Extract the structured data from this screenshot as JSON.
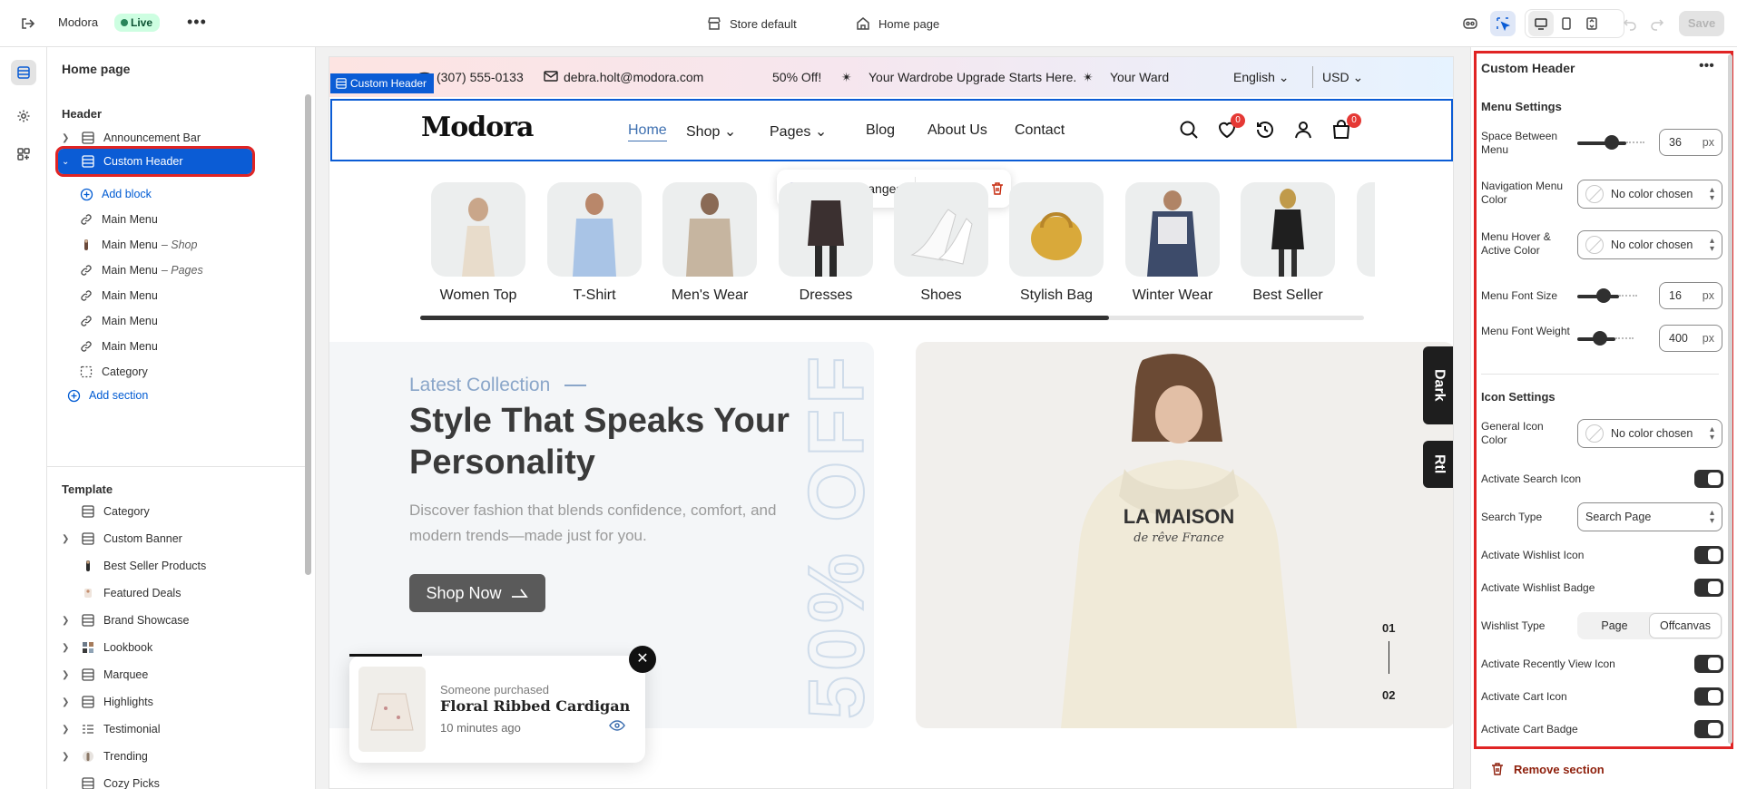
{
  "topbar": {
    "store_name": "Modora",
    "live_badge": "Live",
    "store_select": "Store default",
    "page_select": "Home page",
    "save_label": "Save"
  },
  "sidebar": {
    "title": "Home page",
    "header_group": "Header",
    "header_items": [
      {
        "label": "Announcement Bar",
        "icon": "section-icon"
      },
      {
        "label": "Custom Header",
        "icon": "section-icon"
      },
      {
        "label": "Add block",
        "icon": "add-icon"
      },
      {
        "label": "Main Menu",
        "sub": "",
        "icon": "link-icon"
      },
      {
        "label": "Main Menu",
        "sub": "– Shop",
        "icon": "image-icon"
      },
      {
        "label": "Main Menu",
        "sub": "– Pages",
        "icon": "link-icon"
      },
      {
        "label": "Main Menu",
        "sub": "",
        "icon": "link-icon"
      },
      {
        "label": "Main Menu",
        "sub": "",
        "icon": "link-icon"
      },
      {
        "label": "Main Menu",
        "sub": "",
        "icon": "link-icon"
      },
      {
        "label": "Category",
        "icon": "dashed-box-icon"
      },
      {
        "label": "Add section",
        "icon": "add-icon"
      }
    ],
    "template_group": "Template",
    "template_items": [
      {
        "label": "Category"
      },
      {
        "label": "Custom Banner"
      },
      {
        "label": "Best Seller Products"
      },
      {
        "label": "Featured Deals"
      },
      {
        "label": "Brand Showcase"
      },
      {
        "label": "Lookbook"
      },
      {
        "label": "Marquee"
      },
      {
        "label": "Highlights"
      },
      {
        "label": "Testimonial"
      },
      {
        "label": "Trending"
      },
      {
        "label": "Cozy Picks"
      }
    ]
  },
  "preview": {
    "announcement": {
      "phone": "(307) 555-0133",
      "email": "debra.holt@modora.com",
      "promo1": "50% Off!",
      "promo2": "Your Wardrobe Upgrade Starts Here.",
      "promo3": "Your Ward",
      "language": "English",
      "currency": "USD"
    },
    "header_tag": "Custom Header",
    "logo": "Modora",
    "nav": [
      "Home",
      "Shop",
      "Pages",
      "Blog",
      "About Us",
      "Contact"
    ],
    "wishlist_count": "0",
    "cart_count": "0",
    "ask_changes": "Ask for changes",
    "categories": [
      "Women Top",
      "T-Shirt",
      "Men's Wear",
      "Dresses",
      "Shoes",
      "Stylish Bag",
      "Winter Wear",
      "Best Seller"
    ],
    "category_scroll_progress": 0.73,
    "hero": {
      "subtitle": "Latest Collection",
      "title": "Style That Speaks Your Personality",
      "description": "Discover fashion that blends confidence, comfort, and modern trends—made just for you.",
      "button": "Shop Now",
      "big_text": "50% OFF",
      "hoodie_text": "LA MAISON",
      "hoodie_script": "de rêve France",
      "slide_current": "01",
      "slide_next": "02"
    },
    "side_tabs": [
      "Dark",
      "Rtl"
    ],
    "popup": {
      "line1": "Someone purchased",
      "product": "Floral Ribbed Cardigan",
      "time": "10 minutes ago"
    }
  },
  "panel": {
    "title": "Custom Header",
    "menu_settings": "Menu Settings",
    "space_between_menu": {
      "label": "Space Between Menu",
      "value": "36",
      "unit": "px",
      "level": 0.55
    },
    "nav_menu_color": {
      "label": "Navigation Menu Color",
      "value": "No color chosen"
    },
    "menu_hover_color": {
      "label": "Menu Hover & Active Color",
      "value": "No color chosen"
    },
    "menu_font_size": {
      "label": "Menu Font Size",
      "value": "16",
      "unit": "px",
      "level": 0.45
    },
    "menu_font_weight": {
      "label": "Menu Font Weight",
      "value": "400",
      "unit": "px",
      "level": 0.4
    },
    "icon_settings": "Icon Settings",
    "general_icon_color": {
      "label": "General Icon Color",
      "value": "No color chosen"
    },
    "activate_search_icon": {
      "label": "Activate Search Icon",
      "on": true
    },
    "search_type": {
      "label": "Search Type",
      "value": "Search Page"
    },
    "activate_wishlist_icon": {
      "label": "Activate Wishlist Icon",
      "on": true
    },
    "activate_wishlist_badge": {
      "label": "Activate Wishlist Badge",
      "on": true
    },
    "wishlist_type": {
      "label": "Wishlist Type",
      "options": [
        "Page",
        "Offcanvas"
      ],
      "selected": "Offcanvas"
    },
    "activate_recent_icon": {
      "label": "Activate Recently View Icon",
      "on": true
    },
    "activate_cart_icon": {
      "label": "Activate Cart Icon",
      "on": true
    },
    "activate_cart_badge": {
      "label": "Activate Cart Badge",
      "on": true
    },
    "remove_section": "Remove section"
  },
  "colors": {
    "selection_blue": "#0b5cd5",
    "highlight_red": "#e02424",
    "live_green": "#cdfee1",
    "badge_red": "#e53935"
  }
}
